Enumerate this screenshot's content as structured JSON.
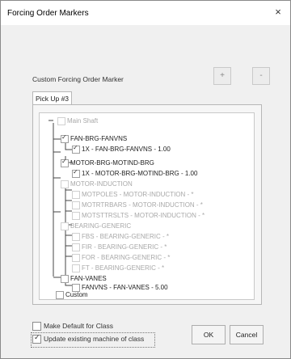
{
  "window": {
    "title": "Forcing Order Markers",
    "close_glyph": "×"
  },
  "custom_marker": {
    "label": "Custom Forcing Order Marker",
    "add_glyph": "+",
    "remove_glyph": "-"
  },
  "tab": {
    "label": "Pick Up #3"
  },
  "tree": [
    {
      "label": "Main Shaft",
      "checked": false,
      "dim": true
    },
    {
      "label": "FAN-BRG-FANVNS",
      "checked": true,
      "dim": false
    },
    {
      "label": "1X - FAN-BRG-FANVNS - 1.00",
      "checked": true,
      "dim": false
    },
    {
      "label": "MOTOR-BRG-MOTIND-BRG",
      "checked": true,
      "dim": false
    },
    {
      "label": "1X - MOTOR-BRG-MOTIND-BRG - 1.00",
      "checked": true,
      "dim": false
    },
    {
      "label": "MOTOR-INDUCTION",
      "checked": false,
      "dim": true
    },
    {
      "label": "MOTPOLES - MOTOR-INDUCTION - *",
      "checked": false,
      "dim": true
    },
    {
      "label": "MOTRTRBARS - MOTOR-INDUCTION - *",
      "checked": false,
      "dim": true
    },
    {
      "label": "MOTSTTRSLTS - MOTOR-INDUCTION - *",
      "checked": false,
      "dim": true
    },
    {
      "label": "BEARING-GENERIC",
      "checked": false,
      "dim": true
    },
    {
      "label": "FBS - BEARING-GENERIC - *",
      "checked": false,
      "dim": true
    },
    {
      "label": "FIR - BEARING-GENERIC - *",
      "checked": false,
      "dim": true
    },
    {
      "label": "FOR - BEARING-GENERIC - *",
      "checked": false,
      "dim": true
    },
    {
      "label": "FT - BEARING-GENERIC - *",
      "checked": false,
      "dim": true
    },
    {
      "label": "FAN-VANES",
      "checked": false,
      "dim": false
    },
    {
      "label": "FANVNS - FAN-VANES - 5.00",
      "checked": false,
      "dim": false
    },
    {
      "label": "Custom",
      "checked": false,
      "dim": false
    }
  ],
  "options": {
    "make_default": {
      "label": "Make Default for Class",
      "checked": false
    },
    "update_existing": {
      "label": "Update existing machine of class",
      "checked": true
    }
  },
  "buttons": {
    "ok": "OK",
    "cancel": "Cancel"
  }
}
